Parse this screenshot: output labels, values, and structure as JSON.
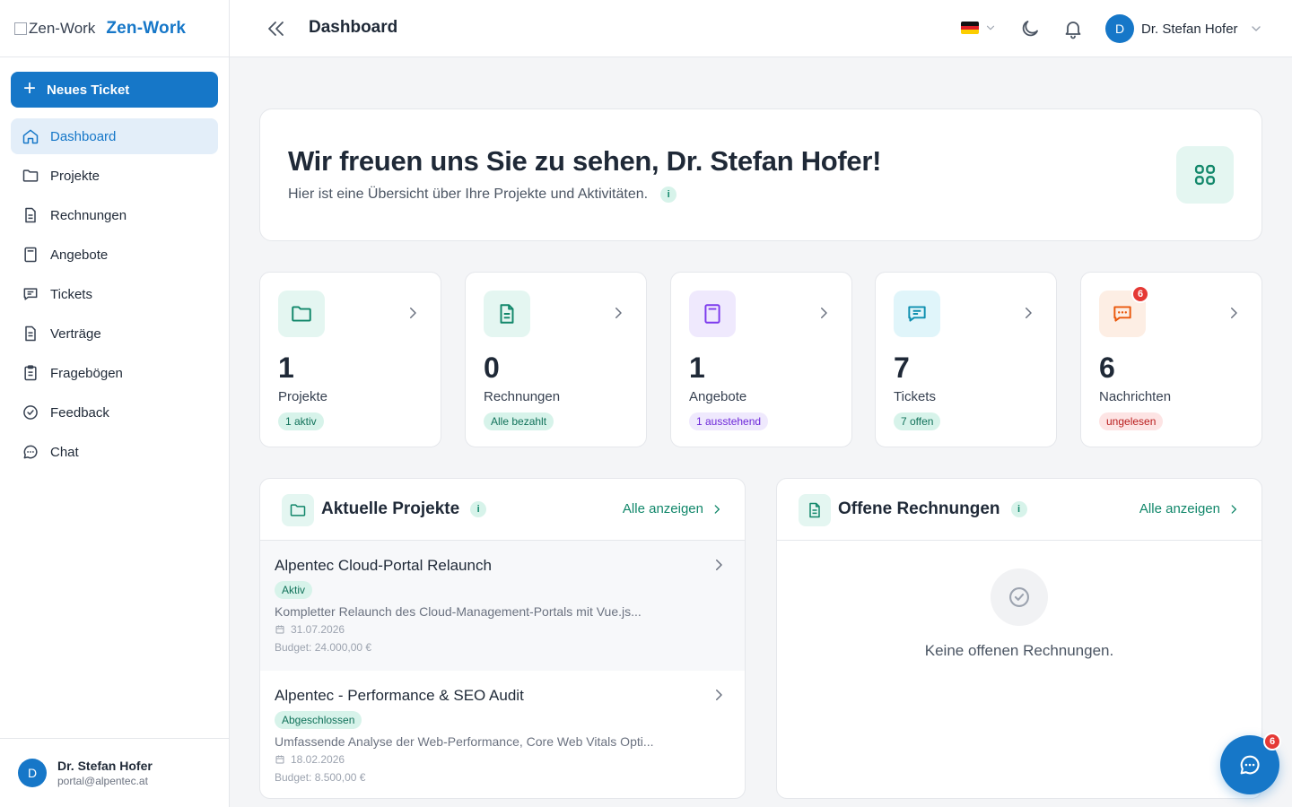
{
  "brand": {
    "logo_alt": "Zen-Work",
    "name": "Zen-Work"
  },
  "sidebar": {
    "new_ticket_label": "Neues Ticket",
    "items": [
      {
        "label": "Dashboard",
        "icon": "home-icon",
        "active": true
      },
      {
        "label": "Projekte",
        "icon": "folder-icon"
      },
      {
        "label": "Rechnungen",
        "icon": "document-icon"
      },
      {
        "label": "Angebote",
        "icon": "calculator-icon"
      },
      {
        "label": "Tickets",
        "icon": "message-square-icon"
      },
      {
        "label": "Verträge",
        "icon": "contract-icon"
      },
      {
        "label": "Fragebögen",
        "icon": "clipboard-icon"
      },
      {
        "label": "Feedback",
        "icon": "check-circle-icon"
      },
      {
        "label": "Chat",
        "icon": "chat-bubble-icon"
      }
    ],
    "user": {
      "initial": "D",
      "name": "Dr. Stefan Hofer",
      "email": "portal@alpentec.at"
    }
  },
  "header": {
    "title": "Dashboard",
    "user": {
      "initial": "D",
      "name": "Dr. Stefan Hofer"
    }
  },
  "welcome": {
    "title": "Wir freuen uns Sie zu sehen, Dr. Stefan Hofer!",
    "subtitle": "Hier ist eine Übersicht über Ihre Projekte und Aktivitäten.",
    "info": "i"
  },
  "stats": [
    {
      "value": "1",
      "label": "Projekte",
      "pill": "1 aktiv",
      "accent": "#11876a"
    },
    {
      "value": "0",
      "label": "Rechnungen",
      "pill": "Alle bezahlt",
      "accent": "#11876a"
    },
    {
      "value": "1",
      "label": "Angebote",
      "pill": "1 ausstehend",
      "accent": "#7c3aed"
    },
    {
      "value": "7",
      "label": "Tickets",
      "pill": "7 offen",
      "accent": "#0e8fb0"
    },
    {
      "value": "6",
      "label": "Nachrichten",
      "pill": "ungelesen",
      "accent": "#ea580c",
      "badge": "6"
    }
  ],
  "projects_panel": {
    "title": "Aktuelle Projekte",
    "info": "i",
    "all_label": "Alle anzeigen",
    "items": [
      {
        "name": "Alpentec Cloud-Portal Relaunch",
        "status": "Aktiv",
        "desc": "Kompletter Relaunch des Cloud-Management-Portals mit Vue.js...",
        "date": "31.07.2026",
        "budget": "Budget: 24.000,00 €"
      },
      {
        "name": "Alpentec - Performance & SEO Audit",
        "status": "Abgeschlossen",
        "desc": "Umfassende Analyse der Web-Performance, Core Web Vitals Opti...",
        "date": "18.02.2026",
        "budget": "Budget: 8.500,00 €"
      }
    ]
  },
  "invoices_panel": {
    "title": "Offene Rechnungen",
    "info": "i",
    "all_label": "Alle anzeigen",
    "empty_text": "Keine offenen Rechnungen."
  },
  "chat_fab": {
    "badge": "6"
  },
  "colors": {
    "primary": "#1677c8",
    "teal": "#11876a",
    "purple": "#7c3aed",
    "cyan": "#0e8fb0",
    "orange": "#ea580c",
    "red": "#e53935"
  }
}
